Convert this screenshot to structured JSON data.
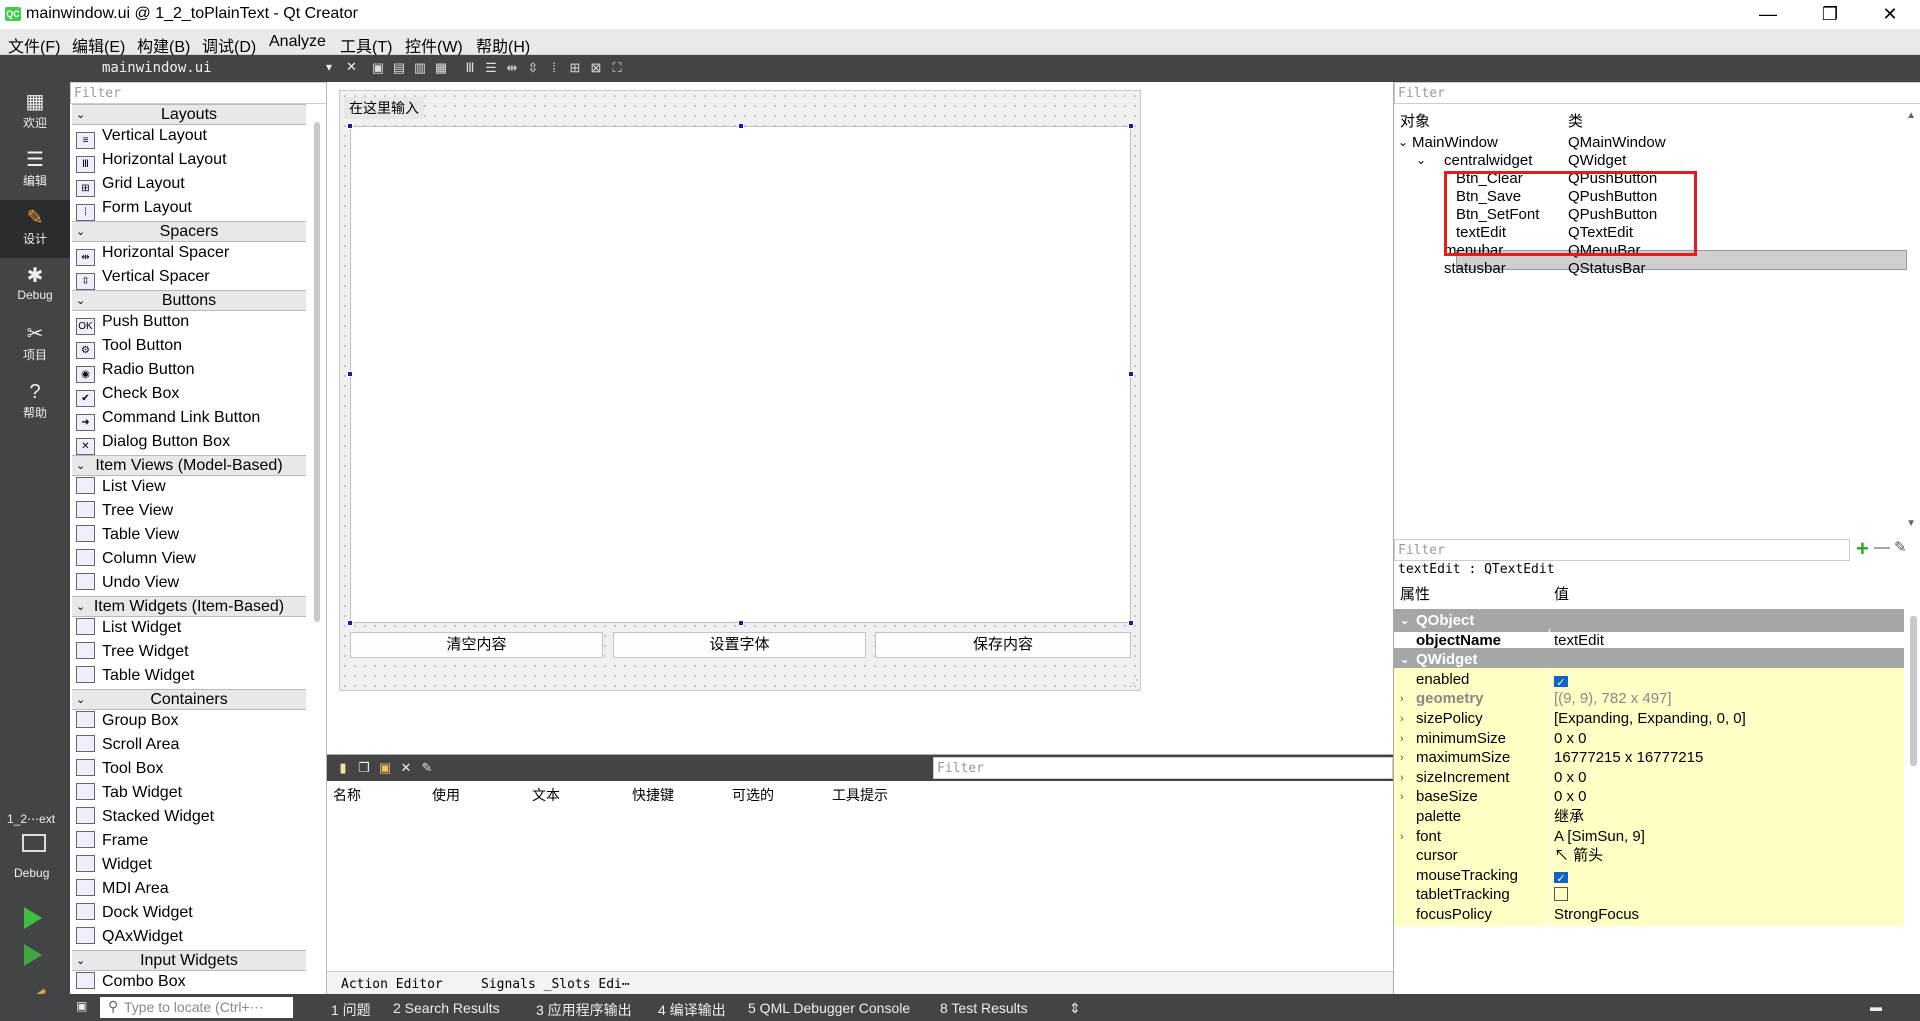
{
  "window": {
    "logo": "QC",
    "title": "mainwindow.ui @ 1_2_toPlainText - Qt Creator",
    "minimize": "—",
    "maximize": "❐",
    "close": "✕"
  },
  "menubar": [
    "文件(F)",
    "编辑(E)",
    "构建(B)",
    "调试(D)",
    "Analyze",
    "工具(T)",
    "控件(W)",
    "帮助(H)"
  ],
  "modes": [
    {
      "label": "欢迎",
      "icon": "▦"
    },
    {
      "label": "编辑",
      "icon": "☰"
    },
    {
      "label": "设计",
      "icon": "✎"
    },
    {
      "label": "Debug",
      "icon": "✱"
    },
    {
      "label": "项目",
      "icon": "✂"
    },
    {
      "label": "帮助",
      "icon": "?"
    }
  ],
  "modebar_bottom": {
    "project": "1_2⋯ext",
    "kit": "Debug"
  },
  "doctoolbar": {
    "filename": "mainwindow.ui",
    "combo_arrow": "▾",
    "close": "✕"
  },
  "widgetbox": {
    "filter": "Filter",
    "categories": [
      {
        "title": "Layouts",
        "items": [
          "Vertical Layout",
          "Horizontal Layout",
          "Grid Layout",
          "Form Layout"
        ]
      },
      {
        "title": "Spacers",
        "items": [
          "Horizontal Spacer",
          "Vertical Spacer"
        ]
      },
      {
        "title": "Buttons",
        "items": [
          "Push Button",
          "Tool Button",
          "Radio Button",
          "Check Box",
          "Command Link Button",
          "Dialog Button Box"
        ]
      },
      {
        "title": "Item Views (Model-Based)",
        "items": [
          "List View",
          "Tree View",
          "Table View",
          "Column View",
          "Undo View"
        ]
      },
      {
        "title": "Item Widgets (Item-Based)",
        "items": [
          "List Widget",
          "Tree Widget",
          "Table Widget"
        ]
      },
      {
        "title": "Containers",
        "items": [
          "Group Box",
          "Scroll Area",
          "Tool Box",
          "Tab Widget",
          "Stacked Widget",
          "Frame",
          "Widget",
          "MDI Area",
          "Dock Widget",
          "QAxWidget"
        ]
      },
      {
        "title": "Input Widgets",
        "items": [
          "Combo Box"
        ]
      }
    ]
  },
  "form": {
    "menu_placeholder": "在这里输入",
    "buttons": [
      "清空内容",
      "设置字体",
      "保存内容"
    ]
  },
  "action_editor": {
    "filter": "Filter",
    "columns": [
      "名称",
      "使用",
      "文本",
      "快捷键",
      "可选的",
      "工具提示"
    ],
    "tabs": [
      "Action Editor",
      "Signals _Slots Edi⋯"
    ]
  },
  "object_inspector": {
    "filter": "Filter",
    "headers": [
      "对象",
      "类"
    ],
    "rows": [
      {
        "name": "MainWindow",
        "cls": "QMainWindow",
        "level": 0,
        "arrow": "⌄"
      },
      {
        "name": "centralwidget",
        "cls": "QWidget",
        "level": 1,
        "arrow": "⌄"
      },
      {
        "name": "Btn_Clear",
        "cls": "QPushButton",
        "level": 2,
        "arrow": ""
      },
      {
        "name": "Btn_Save",
        "cls": "QPushButton",
        "level": 2,
        "arrow": ""
      },
      {
        "name": "Btn_SetFont",
        "cls": "QPushButton",
        "level": 2,
        "arrow": ""
      },
      {
        "name": "textEdit",
        "cls": "QTextEdit",
        "level": 2,
        "arrow": ""
      },
      {
        "name": "menubar",
        "cls": "QMenuBar",
        "level": 1,
        "arrow": ""
      },
      {
        "name": "statusbar",
        "cls": "QStatusBar",
        "level": 1,
        "arrow": ""
      }
    ]
  },
  "property_editor": {
    "filter": "Filter",
    "add": "+",
    "remove": "—",
    "object_label": "textEdit : QTextEdit",
    "headers": [
      "属性",
      "值"
    ],
    "rows": [
      {
        "type": "group",
        "name": "QObject"
      },
      {
        "type": "prop",
        "name": "objectName",
        "value": "textEdit",
        "bold": true,
        "yellow": false
      },
      {
        "type": "group",
        "name": "QWidget"
      },
      {
        "type": "prop",
        "name": "enabled",
        "check": true,
        "yellow": true
      },
      {
        "type": "prop",
        "name": "geometry",
        "value": "[(9, 9), 782 x 497]",
        "expand": true,
        "yellow": true,
        "dim": true
      },
      {
        "type": "prop",
        "name": "sizePolicy",
        "value": "[Expanding, Expanding, 0, 0]",
        "expand": true,
        "yellow": true
      },
      {
        "type": "prop",
        "name": "minimumSize",
        "value": "0 x 0",
        "expand": true,
        "yellow": true
      },
      {
        "type": "prop",
        "name": "maximumSize",
        "value": "16777215 x 16777215",
        "expand": true,
        "yellow": true
      },
      {
        "type": "prop",
        "name": "sizeIncrement",
        "value": "0 x 0",
        "expand": true,
        "yellow": true
      },
      {
        "type": "prop",
        "name": "baseSize",
        "value": "0 x 0",
        "expand": true,
        "yellow": true
      },
      {
        "type": "prop",
        "name": "palette",
        "value": "继承",
        "yellow": true
      },
      {
        "type": "prop",
        "name": "font",
        "value": "A  [SimSun, 9]",
        "expand": true,
        "yellow": true
      },
      {
        "type": "prop",
        "name": "cursor",
        "value": "↖ 箭头",
        "yellow": true
      },
      {
        "type": "prop",
        "name": "mouseTracking",
        "check": true,
        "yellow": true
      },
      {
        "type": "prop",
        "name": "tabletTracking",
        "check": false,
        "yellow": true
      },
      {
        "type": "prop",
        "name": "focusPolicy",
        "value": "StrongFocus",
        "yellow": true
      }
    ]
  },
  "statusbar": {
    "locator": "Type to locate (Ctrl+⋯",
    "panes": [
      "1 问题",
      "2 Search Results",
      "3 应用程序输出",
      "4 编译输出",
      "5 QML Debugger Console",
      "8 Test Results"
    ],
    "arrows": "⇕"
  },
  "colors": {
    "highlight": "#e41c1c",
    "selection": "#1a1aa8",
    "property_yellow": "#ffffc5",
    "group_gray": "#a6a6a6"
  }
}
